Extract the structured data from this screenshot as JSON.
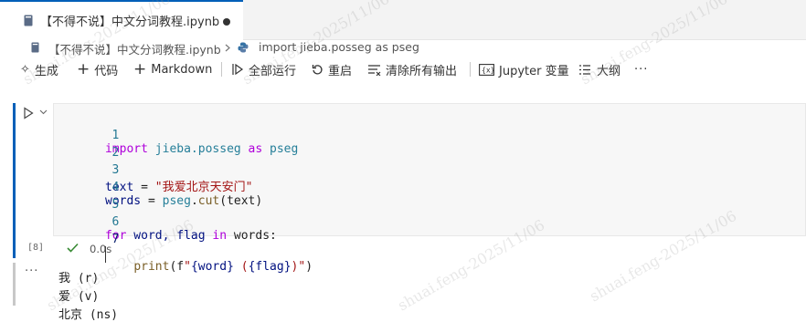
{
  "tab": {
    "title": "【不得不说】中文分词教程.ipynb",
    "modified": true
  },
  "breadcrumb": {
    "file": "【不得不说】中文分词教程.ipynb",
    "symbol": "import jieba.posseg as pseg"
  },
  "toolbar": {
    "generate": "生成",
    "code": "代码",
    "markdown": "Markdown",
    "run_all": "全部运行",
    "restart": "重启",
    "clear_outputs": "清除所有输出",
    "jupyter_vars": "Jupyter 变量",
    "outline": "大纲",
    "more": "···"
  },
  "cell": {
    "exec_count": "[8]",
    "duration": "0.0s",
    "lines": [
      {
        "n": "1"
      },
      {
        "n": "2"
      },
      {
        "n": "3"
      },
      {
        "n": "4"
      },
      {
        "n": "5"
      },
      {
        "n": "6"
      },
      {
        "n": "7"
      }
    ],
    "code": {
      "l1_import": "import",
      "l1_module": "jieba.posseg",
      "l1_as": "as",
      "l1_alias": "pseg",
      "l3_var": "text",
      "l3_eq": " = ",
      "l3_str": "\"我爱北京天安门\"",
      "l4_var": "words",
      "l4_eq": " = ",
      "l4_mod": "pseg",
      "l4_dot": ".",
      "l4_fn": "cut",
      "l4_args": "(text)",
      "l6_for": "for",
      "l6_vars": " word, flag ",
      "l6_in": "in",
      "l6_rest": " words:",
      "l7_indent": "    ",
      "l7_fn": "print",
      "l7_open": "(f",
      "l7_str1": "\"",
      "l7_b1": "{word}",
      "l7_str2": " (",
      "l7_b2": "{flag}",
      "l7_str3": ")\"",
      "l7_close": ")"
    }
  },
  "output": {
    "more": "···",
    "lines": [
      "我 (r)",
      "爱 (v)",
      "北京 (ns)"
    ]
  },
  "watermark": "shuai.feng-2025/11/06",
  "colors": {
    "accent": "#005fb8",
    "keyword": "#af00db",
    "string": "#a31515",
    "line_number": "#237893",
    "success": "#388a34"
  }
}
